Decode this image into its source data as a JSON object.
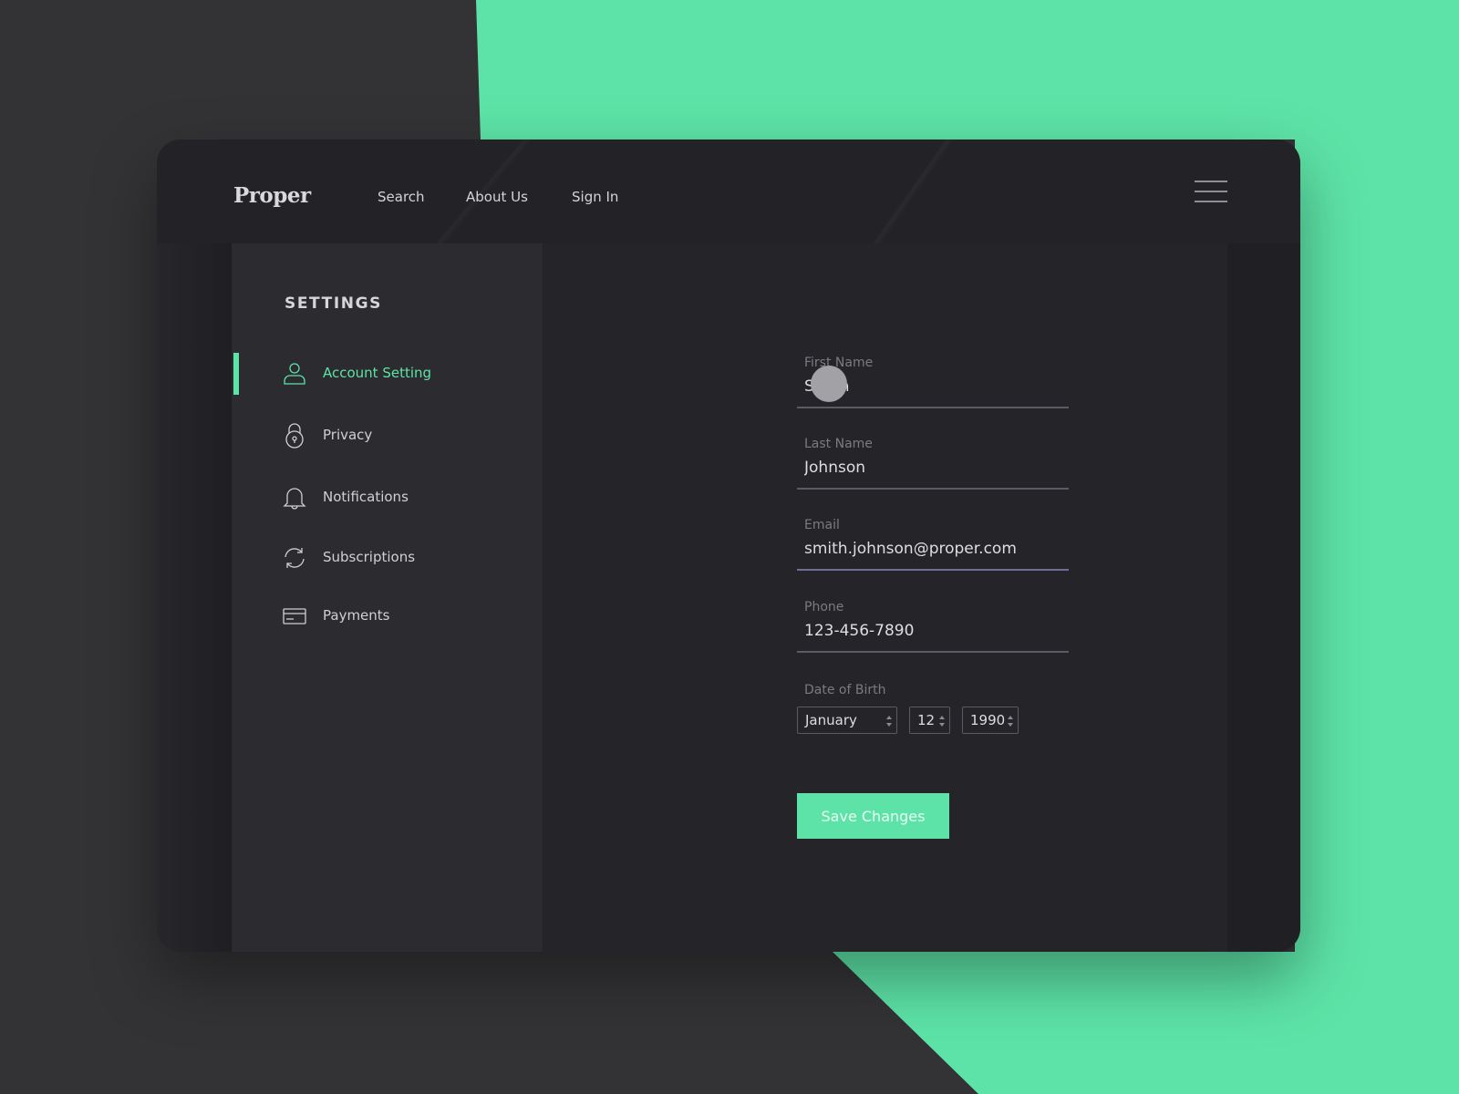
{
  "brand": {
    "logo": "Proper",
    "accent_color": "#5de3a7"
  },
  "nav": {
    "items": [
      {
        "label": "Search"
      },
      {
        "label": "About Us"
      },
      {
        "label": "Sign In"
      }
    ],
    "menu_icon": "hamburger-menu-icon"
  },
  "sidebar": {
    "title": "SETTINGS",
    "items": [
      {
        "label": "Account Setting",
        "icon": "user-icon",
        "active": true
      },
      {
        "label": "Privacy",
        "icon": "lock-icon",
        "active": false
      },
      {
        "label": "Notifications",
        "icon": "bell-icon",
        "active": false
      },
      {
        "label": "Subscriptions",
        "icon": "refresh-icon",
        "active": false
      },
      {
        "label": "Payments",
        "icon": "credit-card-icon",
        "active": false
      }
    ]
  },
  "form": {
    "first_name": {
      "label": "First Name",
      "value": "Smith"
    },
    "last_name": {
      "label": "Last Name",
      "value": "Johnson"
    },
    "email": {
      "label": "Email",
      "value": "smith.johnson@proper.com"
    },
    "phone": {
      "label": "Phone",
      "value": "123-456-7890"
    },
    "dob": {
      "label": "Date of Birth",
      "month": "January",
      "day": "12",
      "year": "1990"
    },
    "save_label": "Save Changes"
  }
}
